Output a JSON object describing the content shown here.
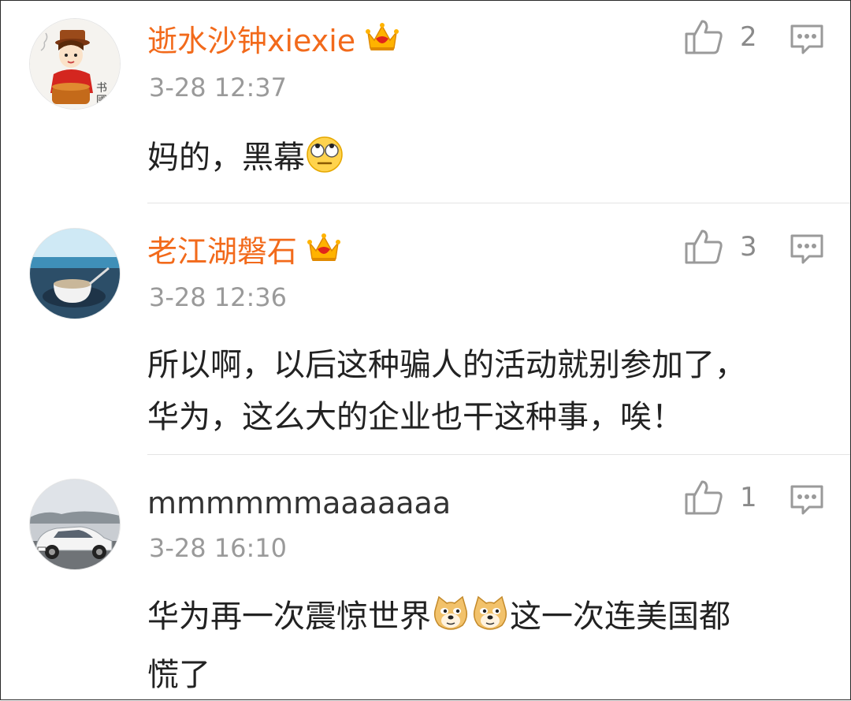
{
  "comments": [
    {
      "username": "逝水沙钟xiexie",
      "vip": true,
      "timestamp": "3-28 12:37",
      "likes": "2",
      "text": "妈的，黑幕",
      "emojis": [
        "eye-roll-emoji"
      ]
    },
    {
      "username": "老江湖磐石",
      "vip": true,
      "timestamp": "3-28 12:36",
      "likes": "3",
      "text_line1": "所以啊，以后这种骗人的活动就别参加了，",
      "text_line2": "华为，这么大的企业也干这种事，唉！"
    },
    {
      "username": "mmmmmmaaaaaaa",
      "vip": false,
      "timestamp": "3-28 16:10",
      "likes": "1",
      "text_part1": "华为再一次震惊世界",
      "text_part2": "这一次连美国都",
      "text_line2": "慌了",
      "emojis": [
        "doge-emoji",
        "doge-emoji"
      ]
    }
  ],
  "icons": {
    "like": "thumbs-up-icon",
    "reply": "comment-reply-icon",
    "badge": "vip-crown-icon"
  },
  "colors": {
    "vip_name": "#f26a1b",
    "normal_name": "#333333",
    "timestamp": "#9a9a9a",
    "icon": "#9a9a9a"
  }
}
